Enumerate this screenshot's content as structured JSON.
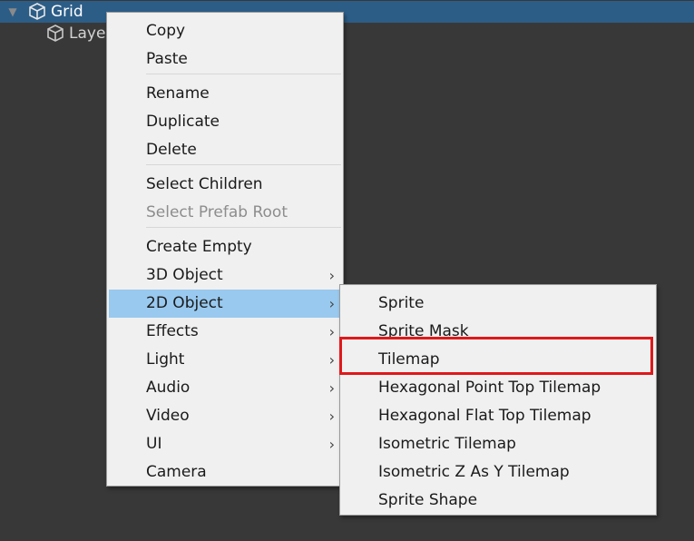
{
  "hierarchy": {
    "rows": [
      {
        "label": "Grid",
        "selected": true
      },
      {
        "label": "Laye",
        "selected": false
      }
    ]
  },
  "context_menu": {
    "items": [
      {
        "label": "Copy"
      },
      {
        "label": "Paste"
      },
      {
        "label": "Rename"
      },
      {
        "label": "Duplicate"
      },
      {
        "label": "Delete"
      },
      {
        "label": "Select Children"
      },
      {
        "label": "Select Prefab Root",
        "disabled": true
      },
      {
        "label": "Create Empty"
      },
      {
        "label": "3D Object",
        "submenu": true
      },
      {
        "label": "2D Object",
        "submenu": true,
        "active": true
      },
      {
        "label": "Effects",
        "submenu": true
      },
      {
        "label": "Light",
        "submenu": true
      },
      {
        "label": "Audio",
        "submenu": true
      },
      {
        "label": "Video",
        "submenu": true
      },
      {
        "label": "UI",
        "submenu": true
      },
      {
        "label": "Camera"
      }
    ],
    "chevron": "›"
  },
  "submenu_2d": {
    "items": [
      {
        "label": "Sprite"
      },
      {
        "label": "Sprite Mask"
      },
      {
        "label": "Tilemap",
        "highlighted": true
      },
      {
        "label": "Hexagonal Point Top Tilemap"
      },
      {
        "label": "Hexagonal Flat Top Tilemap"
      },
      {
        "label": "Isometric Tilemap"
      },
      {
        "label": "Isometric Z As Y Tilemap"
      },
      {
        "label": "Sprite Shape"
      }
    ]
  },
  "icons": {
    "expand": "▼",
    "gameobject": "cube-icon"
  },
  "colors": {
    "selection": "#2c5d87",
    "menu_active": "#99c9ef",
    "annotation": "#e0181a"
  }
}
